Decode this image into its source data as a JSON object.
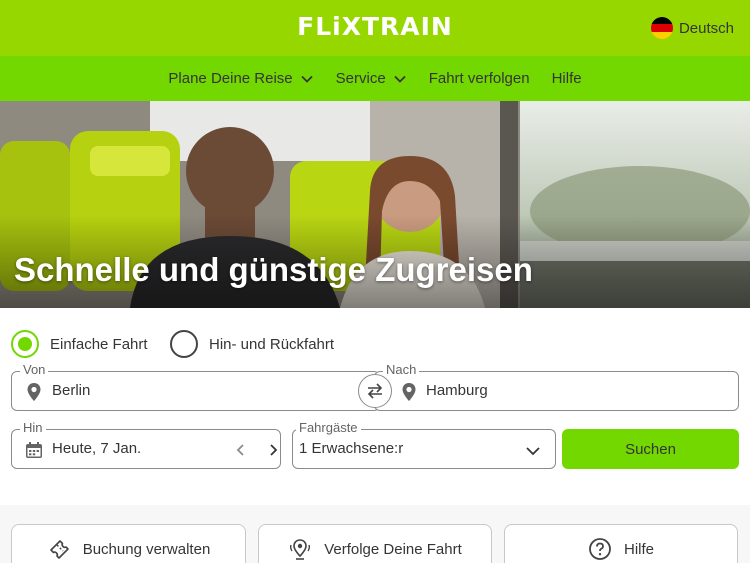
{
  "header": {
    "logo_text": "FLiXTRAIN",
    "language_label": "Deutsch"
  },
  "nav": {
    "items": [
      {
        "label": "Plane Deine Reise",
        "dropdown": true
      },
      {
        "label": "Service",
        "dropdown": true
      },
      {
        "label": "Fahrt verfolgen",
        "dropdown": false
      },
      {
        "label": "Hilfe",
        "dropdown": false
      }
    ]
  },
  "hero": {
    "title": "Schnelle und günstige Zugreisen"
  },
  "search": {
    "trip_type": {
      "one_way": "Einfache Fahrt",
      "round_trip": "Hin- und Rückfahrt",
      "selected": "one_way"
    },
    "from": {
      "label": "Von",
      "value": "Berlin"
    },
    "to": {
      "label": "Nach",
      "value": "Hamburg"
    },
    "date": {
      "label": "Hin",
      "value": "Heute, 7 Jan."
    },
    "passengers": {
      "label": "Fahrgäste",
      "value": "1 Erwachsene:r"
    },
    "submit_label": "Suchen"
  },
  "quick_links": [
    {
      "label": "Buchung verwalten",
      "icon": "ticket-icon"
    },
    {
      "label": "Verfolge Deine Fahrt",
      "icon": "location-tracking-icon"
    },
    {
      "label": "Hilfe",
      "icon": "help-circle-icon"
    }
  ],
  "colors": {
    "brand": "#73d700",
    "brand_light": "#97d700",
    "text": "#353535"
  }
}
